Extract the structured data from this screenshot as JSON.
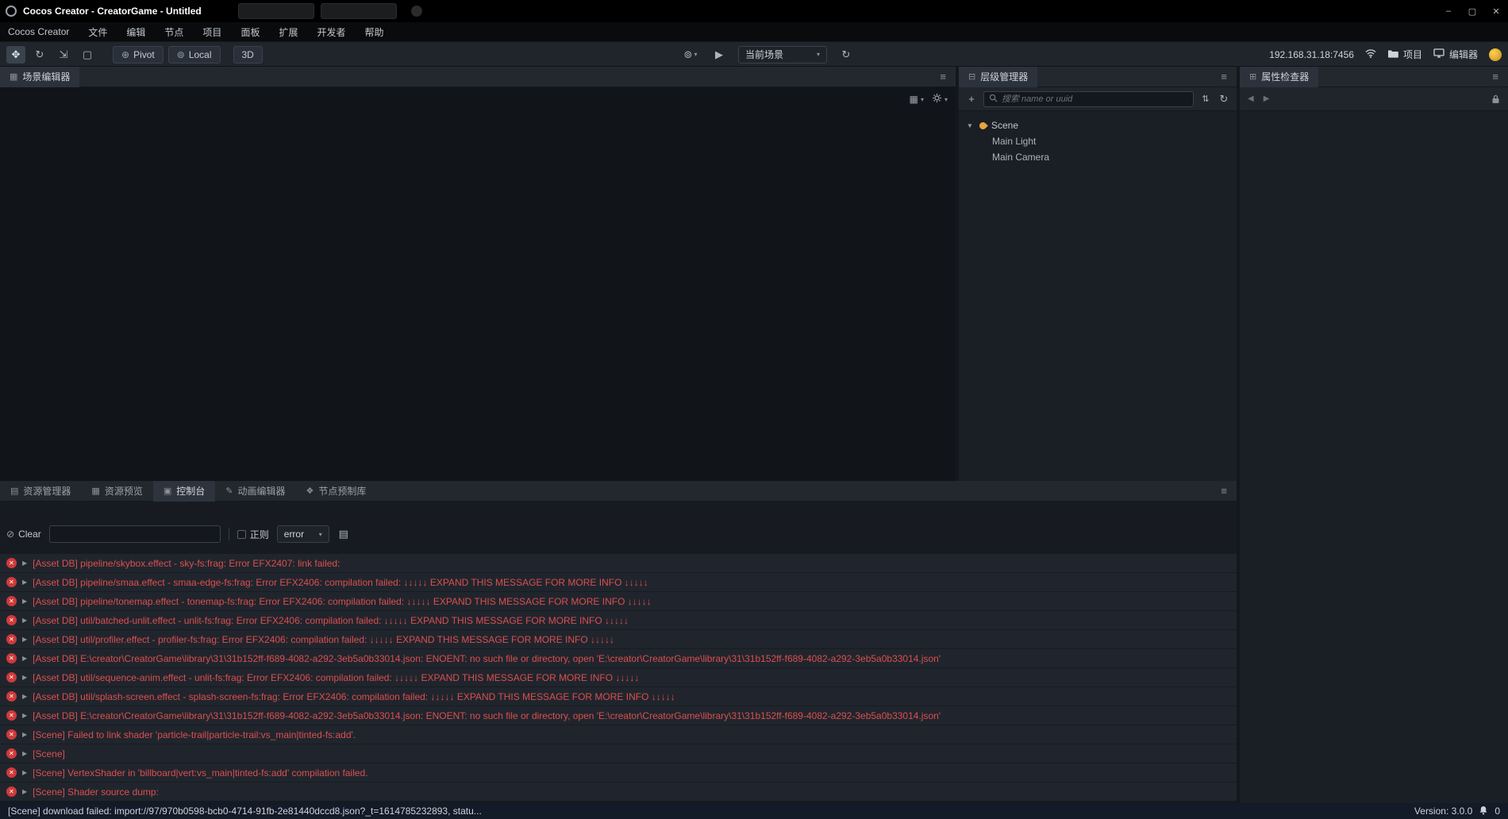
{
  "window": {
    "title": "Cocos Creator - CreatorGame - Untitled",
    "controls": {
      "minimize": "–",
      "maximize": "▢",
      "close": "✕"
    }
  },
  "menu": {
    "items": [
      "Cocos Creator",
      "文件",
      "编辑",
      "节点",
      "项目",
      "面板",
      "扩展",
      "开发者",
      "帮助"
    ]
  },
  "toolbar": {
    "pivot_label": "Pivot",
    "local_label": "Local",
    "mode_3d": "3D",
    "scene_select": "当前场景",
    "address": "192.168.31.18:7456",
    "project_label": "项目",
    "editor_label": "编辑器"
  },
  "scene_panel": {
    "title": "场景编辑器",
    "icon": "▦"
  },
  "hierarchy": {
    "title": "层级管理器",
    "icon": "⊟",
    "search_placeholder": "搜索 name or uuid",
    "tree": {
      "root": "Scene",
      "children": [
        "Main Light",
        "Main Camera"
      ]
    }
  },
  "inspector": {
    "title": "属性检查器",
    "icon": "⊞"
  },
  "bottom_tabs": [
    {
      "label": "资源管理器",
      "icon": "▤"
    },
    {
      "label": "资源预览",
      "icon": "▦"
    },
    {
      "label": "控制台",
      "icon": "▣",
      "active": true
    },
    {
      "label": "动画编辑器",
      "icon": "✎"
    },
    {
      "label": "节点预制库",
      "icon": "❖"
    }
  ],
  "console": {
    "clear_label": "Clear",
    "regex_label": "正则",
    "filter_value": "error",
    "rows": [
      "[Asset DB] pipeline/skybox.effect - sky-fs:frag: Error EFX2407: link failed:",
      "[Asset DB] pipeline/smaa.effect - smaa-edge-fs:frag: Error EFX2406: compilation failed: ↓↓↓↓↓ EXPAND THIS MESSAGE FOR MORE INFO ↓↓↓↓↓",
      "[Asset DB] pipeline/tonemap.effect - tonemap-fs:frag: Error EFX2406: compilation failed: ↓↓↓↓↓ EXPAND THIS MESSAGE FOR MORE INFO ↓↓↓↓↓",
      "[Asset DB] util/batched-unlit.effect - unlit-fs:frag: Error EFX2406: compilation failed: ↓↓↓↓↓ EXPAND THIS MESSAGE FOR MORE INFO ↓↓↓↓↓",
      "[Asset DB] util/profiler.effect - profiler-fs:frag: Error EFX2406: compilation failed: ↓↓↓↓↓ EXPAND THIS MESSAGE FOR MORE INFO ↓↓↓↓↓",
      "[Asset DB] E:\\creator\\CreatorGame\\library\\31\\31b152ff-f689-4082-a292-3eb5a0b33014.json: ENOENT: no such file or directory, open 'E:\\creator\\CreatorGame\\library\\31\\31b152ff-f689-4082-a292-3eb5a0b33014.json'",
      "[Asset DB] util/sequence-anim.effect - unlit-fs:frag: Error EFX2406: compilation failed: ↓↓↓↓↓ EXPAND THIS MESSAGE FOR MORE INFO ↓↓↓↓↓",
      "[Asset DB] util/splash-screen.effect - splash-screen-fs:frag: Error EFX2406: compilation failed: ↓↓↓↓↓ EXPAND THIS MESSAGE FOR MORE INFO ↓↓↓↓↓",
      "[Asset DB] E:\\creator\\CreatorGame\\library\\31\\31b152ff-f689-4082-a292-3eb5a0b33014.json: ENOENT: no such file or directory, open 'E:\\creator\\CreatorGame\\library\\31\\31b152ff-f689-4082-a292-3eb5a0b33014.json'",
      "[Scene] Failed to link shader 'particle-trail|particle-trail:vs_main|tinted-fs:add'.",
      "[Scene]",
      "[Scene] VertexShader in 'billboard|vert:vs_main|tinted-fs:add' compilation failed.",
      "[Scene] Shader source dump:"
    ]
  },
  "statusbar": {
    "message": "[Scene] download failed: import://97/970b0598-bcb0-4714-91fb-2e81440dccd8.json?_t=1614785232893, statu...",
    "version": "Version: 3.0.0",
    "notifications": "0"
  }
}
